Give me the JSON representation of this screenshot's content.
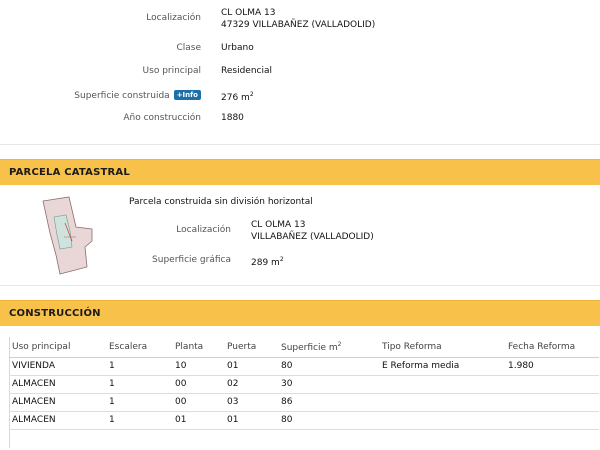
{
  "property": {
    "localizacion_label": "Localización",
    "localizacion_line1": "CL OLMA 13",
    "localizacion_line2": "47329 VILLABAÑEZ (VALLADOLID)",
    "clase_label": "Clase",
    "clase_value": "Urbano",
    "uso_label": "Uso principal",
    "uso_value": "Residencial",
    "superficie_label": "Superficie construida",
    "info_badge": "+Info",
    "superficie_value": "276 m",
    "superficie_unit_sup": "2",
    "anio_label": "Año construcción",
    "anio_value": "1880"
  },
  "parcela": {
    "header": "PARCELA CATASTRAL",
    "tipo": "Parcela construida sin división horizontal",
    "localizacion_label": "Localización",
    "localizacion_line1": "CL OLMA 13",
    "localizacion_line2": "VILLABAÑEZ (VALLADOLID)",
    "superficie_label": "Superficie gráfica",
    "superficie_value": "289 m",
    "superficie_unit_sup": "2"
  },
  "construccion": {
    "header": "CONSTRUCCIÓN",
    "columns": [
      "Uso principal",
      "Escalera",
      "Planta",
      "Puerta",
      "Superficie m",
      "Tipo Reforma",
      "Fecha Reforma"
    ],
    "superficie_col_sup": "2",
    "rows": [
      [
        "VIVIENDA",
        "1",
        "10",
        "01",
        "80",
        "E Reforma media",
        "1.980"
      ],
      [
        "ALMACEN",
        "1",
        "00",
        "02",
        "30",
        "",
        ""
      ],
      [
        "ALMACEN",
        "1",
        "00",
        "03",
        "86",
        "",
        ""
      ],
      [
        "ALMACEN",
        "1",
        "01",
        "01",
        "80",
        "",
        ""
      ]
    ]
  },
  "colors": {
    "section_header": "#f7c14a",
    "info_badge": "#1d6fa5",
    "parcel_fill": "#e9d6d6",
    "building_fill": "#cfe3dc"
  }
}
